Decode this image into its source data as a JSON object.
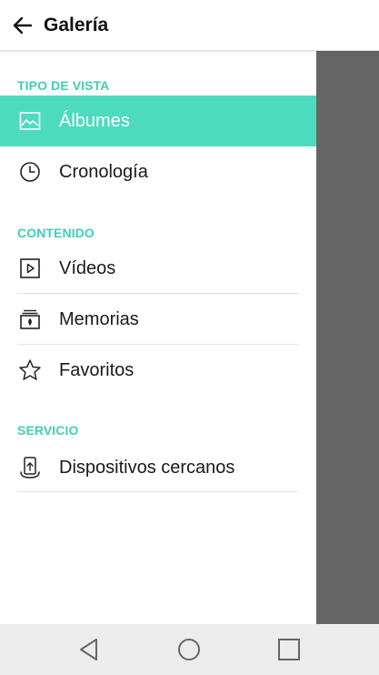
{
  "header": {
    "title": "Galería",
    "back_icon": "arrow-left-icon"
  },
  "sections": [
    {
      "title": "TIPO DE VISTA",
      "items": [
        {
          "label": "Álbumes",
          "icon": "image-icon",
          "selected": true
        },
        {
          "label": "Cronología",
          "icon": "clock-icon",
          "selected": false
        }
      ]
    },
    {
      "title": "CONTENIDO",
      "items": [
        {
          "label": "Vídeos",
          "icon": "video-icon",
          "selected": false
        },
        {
          "label": "Memorias",
          "icon": "memories-icon",
          "selected": false
        },
        {
          "label": "Favoritos",
          "icon": "star-icon",
          "selected": false
        }
      ]
    },
    {
      "title": "SERVICIO",
      "items": [
        {
          "label": "Dispositivos cercanos",
          "icon": "nearby-devices-icon",
          "selected": false
        }
      ]
    }
  ],
  "colors": {
    "accent": "#4cdbbf",
    "section_title": "#3fcfb4",
    "scrim": "#666666",
    "navbar": "#ececec"
  },
  "navbar": {
    "icons": [
      "back-triangle-icon",
      "home-circle-icon",
      "recents-square-icon"
    ]
  }
}
